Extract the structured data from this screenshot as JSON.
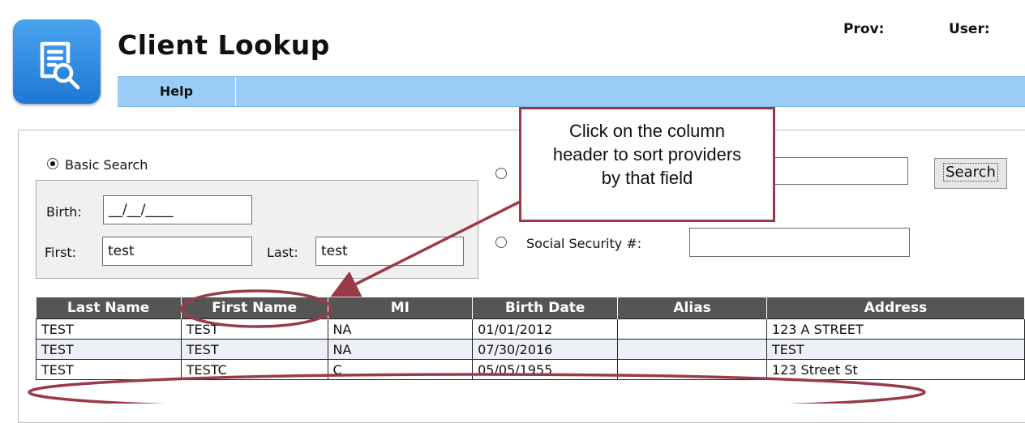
{
  "header": {
    "title": "Client Lookup",
    "prov_label": "Prov:",
    "user_label": "User:",
    "app_icon": "document-search-icon"
  },
  "menu": {
    "items": [
      {
        "label": "Help"
      }
    ]
  },
  "search": {
    "basic_search_label": "Basic Search",
    "basic_search_selected": true,
    "birth_label": "Birth:",
    "birth_value": "__/__/____",
    "first_label": "First:",
    "first_value": "test",
    "last_label": "Last:",
    "last_value": "test",
    "option2_value": "",
    "ssn_label": "Social Security #:",
    "ssn_value": "",
    "search_button": "Search"
  },
  "callout": {
    "lines": [
      "Click on the column",
      "header to sort providers",
      "by that field"
    ]
  },
  "table": {
    "columns": [
      "Last Name",
      "First Name",
      "MI",
      "Birth Date",
      "Alias",
      "Address"
    ],
    "rows": [
      [
        "TEST",
        "TEST",
        "NA",
        "01/01/2012",
        "",
        "123 A STREET"
      ],
      [
        "TEST",
        "TEST",
        "NA",
        "07/30/2016",
        "",
        "TEST"
      ],
      [
        "TEST",
        "TESTC",
        "C",
        "05/05/1955",
        "",
        "123 Street St"
      ]
    ]
  },
  "colors": {
    "menubar": "#99cdf8",
    "table_header": "#555555",
    "callout_border": "#9a3a48",
    "alt_row": "#eef0f8"
  }
}
